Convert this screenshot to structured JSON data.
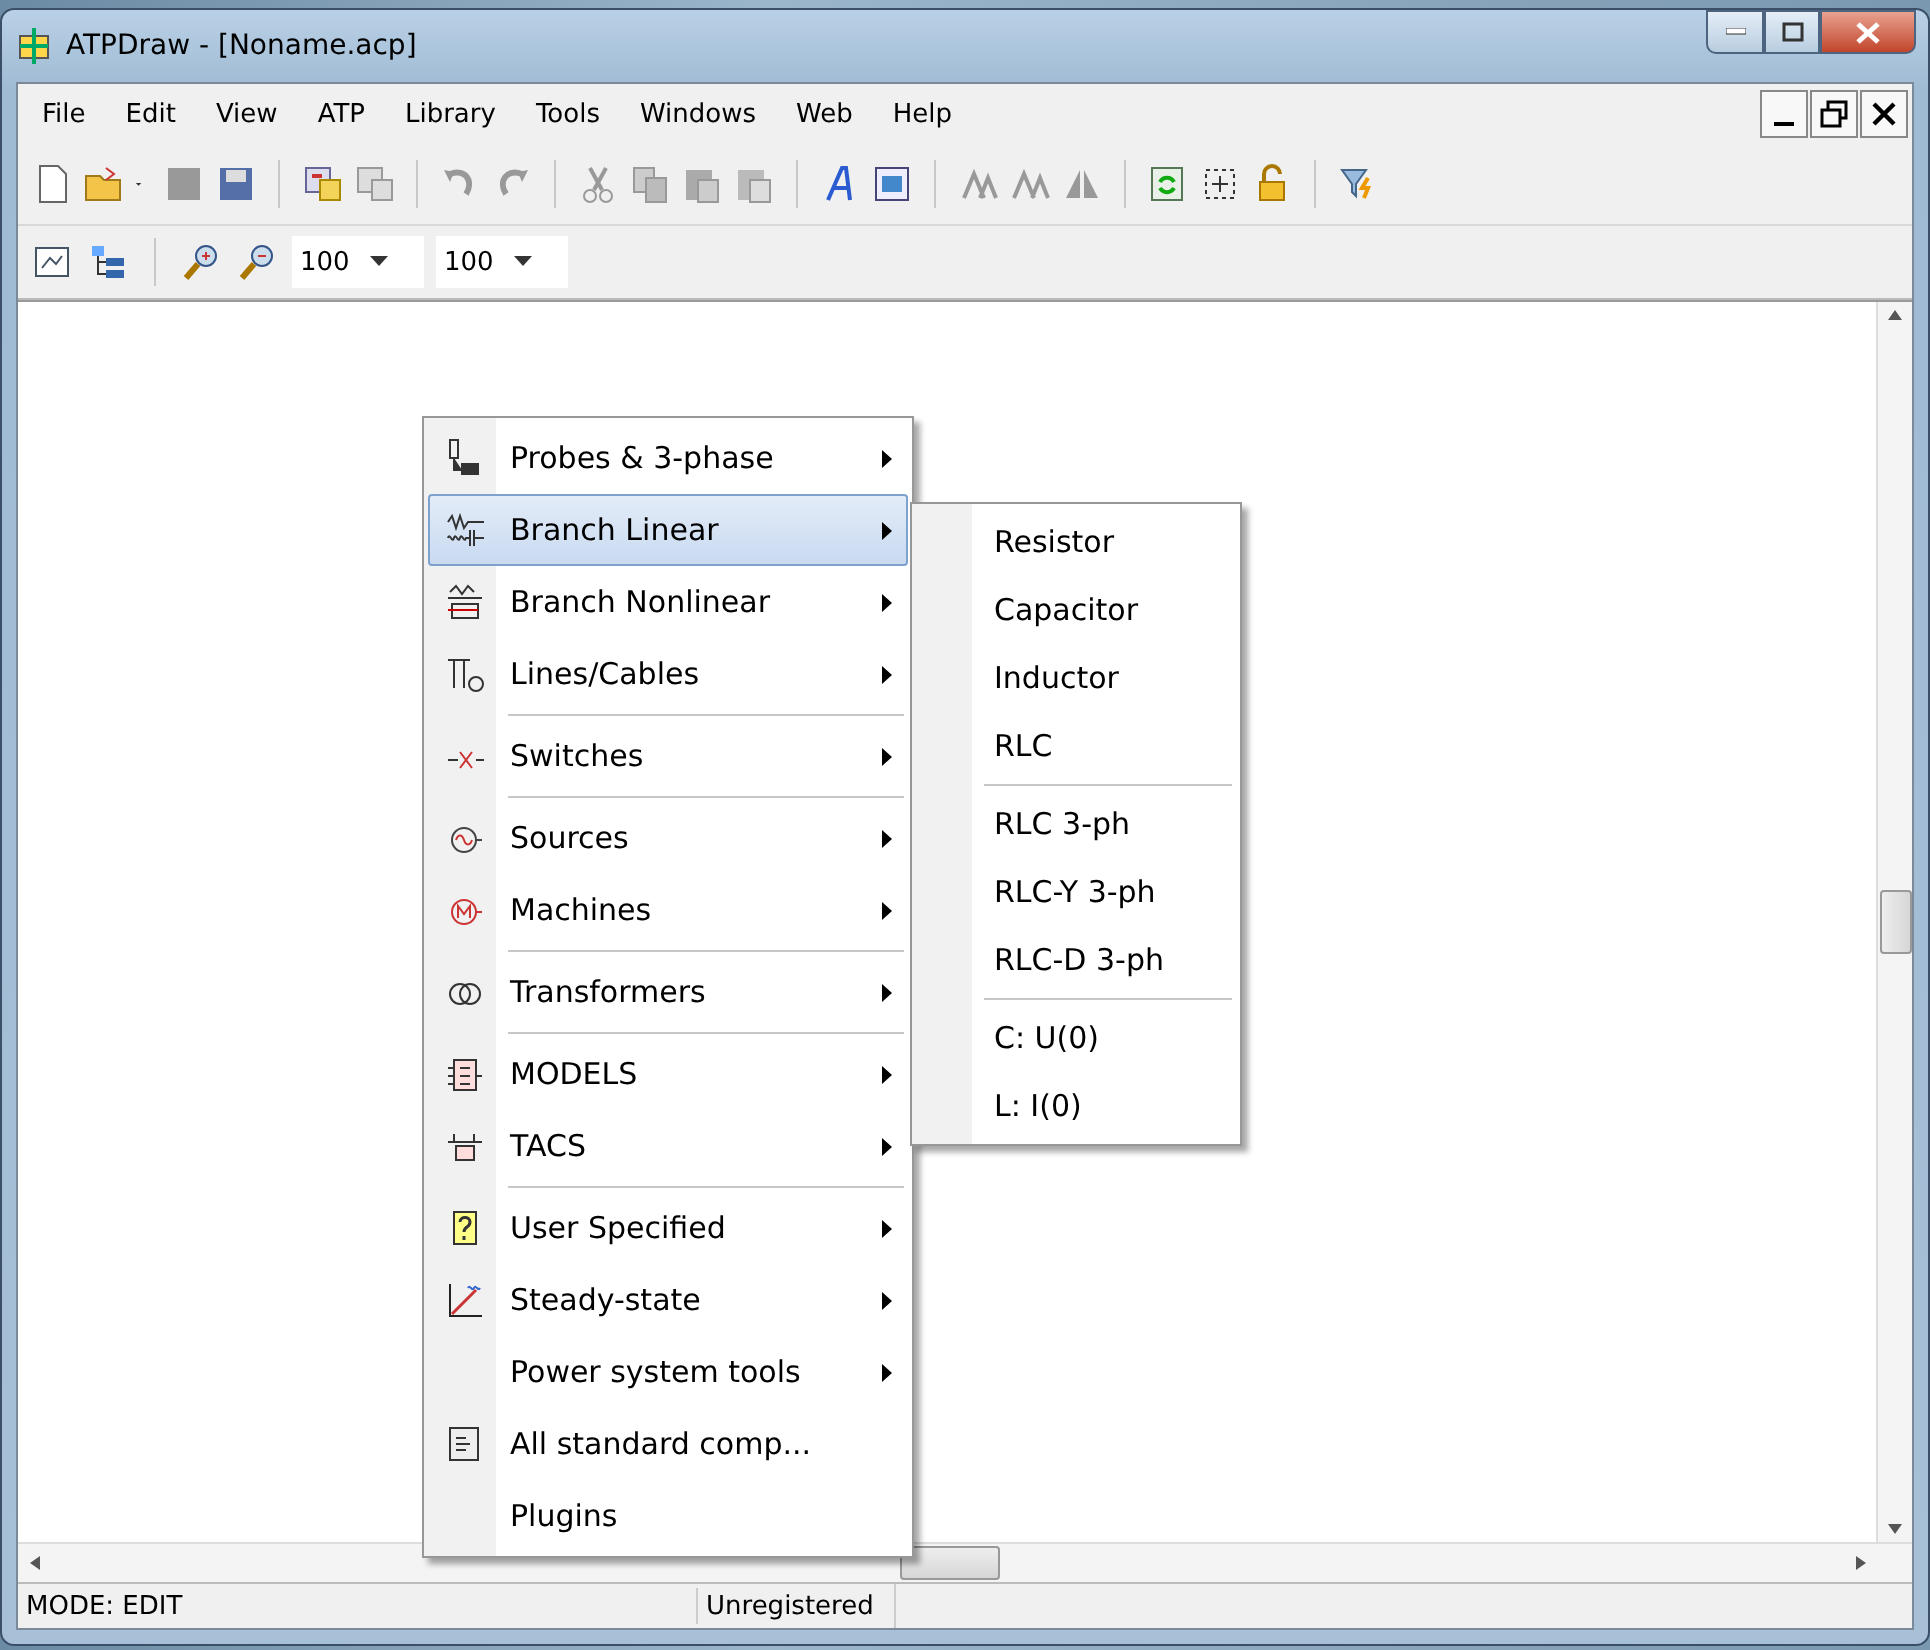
{
  "window": {
    "title": "ATPDraw - [Noname.acp]"
  },
  "menubar": [
    "File",
    "Edit",
    "View",
    "ATP",
    "Library",
    "Tools",
    "Windows",
    "Web",
    "Help"
  ],
  "zoom_boxes": [
    {
      "value": "100"
    },
    {
      "value": "100"
    }
  ],
  "context_menu": {
    "groups": [
      [
        {
          "label": "Probes & 3-phase",
          "kind": "probe",
          "has_submenu": true,
          "selected": false
        },
        {
          "label": "Branch Linear",
          "kind": "rlc",
          "has_submenu": true,
          "selected": true
        },
        {
          "label": "Branch Nonlinear",
          "kind": "nonlinear",
          "has_submenu": true,
          "selected": false
        },
        {
          "label": "Lines/Cables",
          "kind": "line",
          "has_submenu": true,
          "selected": false
        }
      ],
      [
        {
          "label": "Switches",
          "kind": "switch",
          "has_submenu": true,
          "selected": false
        }
      ],
      [
        {
          "label": "Sources",
          "kind": "source",
          "has_submenu": true,
          "selected": false
        },
        {
          "label": "Machines",
          "kind": "machine",
          "has_submenu": true,
          "selected": false
        }
      ],
      [
        {
          "label": "Transformers",
          "kind": "transformer",
          "has_submenu": true,
          "selected": false
        }
      ],
      [
        {
          "label": "MODELS",
          "kind": "models",
          "has_submenu": true,
          "selected": false
        },
        {
          "label": "TACS",
          "kind": "tacs",
          "has_submenu": true,
          "selected": false
        }
      ],
      [
        {
          "label": "User Specified",
          "kind": "user",
          "has_submenu": true,
          "selected": false
        },
        {
          "label": "Steady-state",
          "kind": "steady",
          "has_submenu": true,
          "selected": false
        },
        {
          "label": "Power system tools",
          "kind": "plain",
          "has_submenu": true,
          "selected": false
        },
        {
          "label": "All standard comp...",
          "kind": "list",
          "has_submenu": false,
          "selected": false
        },
        {
          "label": "Plugins",
          "kind": "plain",
          "has_submenu": false,
          "selected": false
        }
      ]
    ]
  },
  "submenu": {
    "groups": [
      [
        {
          "label": "Resistor"
        },
        {
          "label": "Capacitor"
        },
        {
          "label": "Inductor"
        },
        {
          "label": "RLC"
        }
      ],
      [
        {
          "label": "RLC 3-ph"
        },
        {
          "label": "RLC-Y 3-ph"
        },
        {
          "label": "RLC-D 3-ph"
        }
      ],
      [
        {
          "label": "C: U(0)"
        },
        {
          "label": "L: I(0)"
        }
      ]
    ]
  },
  "status_bar": [
    "MODE: EDIT",
    "Unregistered"
  ]
}
